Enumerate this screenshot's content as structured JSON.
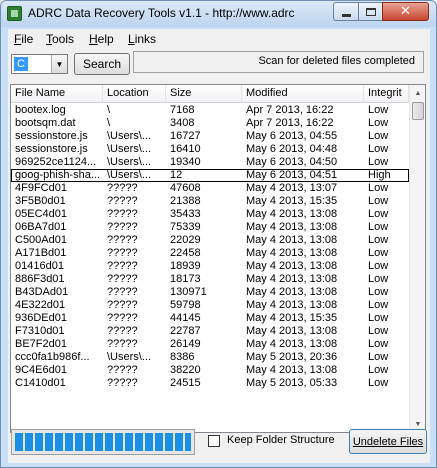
{
  "window": {
    "title": "ADRC Data Recovery Tools v1.1 - http://www.adrc",
    "close_glyph": "✕",
    "maximize_glyph": "",
    "minimize_glyph": ""
  },
  "menu": {
    "items": [
      "File",
      "Tools",
      "Help",
      "Links"
    ]
  },
  "toolbar": {
    "drive_value": "C",
    "search_label": "Search",
    "status_text": "Scan for deleted files completed"
  },
  "table": {
    "columns": [
      "File Name",
      "Location",
      "Size",
      "Modified",
      "Integrit"
    ],
    "rows": [
      [
        "bootex.log",
        "\\",
        "7168",
        "Apr 7 2013, 16:22",
        "Low"
      ],
      [
        "bootsqm.dat",
        "\\",
        "3408",
        "Apr 7 2013, 16:22",
        "Low"
      ],
      [
        "sessionstore.js",
        "\\Users\\...",
        "16727",
        "May 6 2013, 04:55",
        "Low"
      ],
      [
        "sessionstore.js",
        "\\Users\\...",
        "16410",
        "May 6 2013, 04:48",
        "Low"
      ],
      [
        "969252ce1124...",
        "\\Users\\...",
        "19340",
        "May 6 2013, 04:50",
        "Low"
      ],
      [
        "goog-phish-sha...",
        "\\Users\\...",
        "12",
        "May 6 2013, 04:51",
        "High"
      ],
      [
        "4F9FCd01",
        "?????",
        "47608",
        "May 4 2013, 13:07",
        "Low"
      ],
      [
        "3F5B0d01",
        "?????",
        "21388",
        "May 4 2013, 15:35",
        "Low"
      ],
      [
        "05EC4d01",
        "?????",
        "35433",
        "May 4 2013, 13:08",
        "Low"
      ],
      [
        "06BA7d01",
        "?????",
        "75339",
        "May 4 2013, 13:08",
        "Low"
      ],
      [
        "C500Ad01",
        "?????",
        "22029",
        "May 4 2013, 13:08",
        "Low"
      ],
      [
        "A171Bd01",
        "?????",
        "22458",
        "May 4 2013, 13:08",
        "Low"
      ],
      [
        "01416d01",
        "?????",
        "18939",
        "May 4 2013, 13:08",
        "Low"
      ],
      [
        "886F3d01",
        "?????",
        "18173",
        "May 4 2013, 13:08",
        "Low"
      ],
      [
        "B43DAd01",
        "?????",
        "130971",
        "May 4 2013, 13:08",
        "Low"
      ],
      [
        "4E322d01",
        "?????",
        "59798",
        "May 4 2013, 13:08",
        "Low"
      ],
      [
        "936DEd01",
        "?????",
        "44145",
        "May 4 2013, 15:35",
        "Low"
      ],
      [
        "F7310d01",
        "?????",
        "22787",
        "May 4 2013, 13:08",
        "Low"
      ],
      [
        "BE7F2d01",
        "?????",
        "26149",
        "May 4 2013, 13:08",
        "Low"
      ],
      [
        "ccc0fa1b986f...",
        "\\Users\\...",
        "8386",
        "May 5 2013, 20:36",
        "Low"
      ],
      [
        "9C4E6d01",
        "?????",
        "38220",
        "May 4 2013, 13:08",
        "Low"
      ],
      [
        "C1410d01",
        "?????",
        "24515",
        "May 5 2013, 05:33",
        "Low"
      ]
    ],
    "focused_row": 5,
    "scroll_up_glyph": "▲",
    "scroll_down_glyph": "▼"
  },
  "progress": {
    "fraction": 1.0
  },
  "options": {
    "keep_folder_label": "Keep Folder Structure",
    "keep_folder_checked": false
  },
  "actions": {
    "undelete_label": "Undelete Files"
  }
}
